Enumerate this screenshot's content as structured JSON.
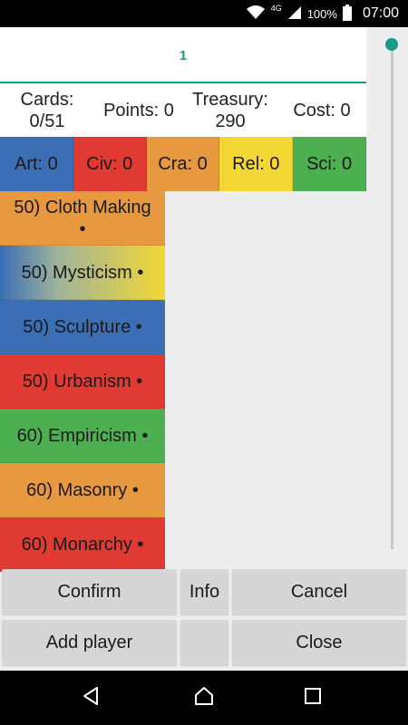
{
  "status_bar": {
    "network": "4G",
    "battery": "100%",
    "time": "07:00"
  },
  "player_tab": {
    "label": "1"
  },
  "stats": {
    "cards": "Cards:\n0/51",
    "points": "Points: 0",
    "treasury": "Treasury:\n290",
    "cost": "Cost: 0"
  },
  "categories": [
    {
      "label": "Art: 0",
      "color": "#3b6eb5"
    },
    {
      "label": "Civ: 0",
      "color": "#e03a33"
    },
    {
      "label": "Cra: 0",
      "color": "#e8983e"
    },
    {
      "label": "Rel: 0",
      "color": "#f3d835"
    },
    {
      "label": "Sci: 0",
      "color": "#4caf50"
    }
  ],
  "cards": [
    {
      "label": "50) Cloth Making\n•",
      "color": "#e8983e"
    },
    {
      "label": "50) Mysticism •",
      "color": "gradient-blue-yellow"
    },
    {
      "label": "50) Sculpture •",
      "color": "#3b6eb5"
    },
    {
      "label": "50) Urbanism •",
      "color": "#e03a33"
    },
    {
      "label": "60) Empiricism •",
      "color": "#4caf50"
    },
    {
      "label": "60) Masonry •",
      "color": "#e8983e"
    },
    {
      "label": "60) Monarchy •",
      "color": "#e03a33"
    }
  ],
  "buttons": {
    "confirm": "Confirm",
    "info": "Info",
    "cancel": "Cancel",
    "add_player": "Add player",
    "blank": "",
    "close": "Close"
  },
  "colors": {
    "accent": "#1a9a8a"
  }
}
